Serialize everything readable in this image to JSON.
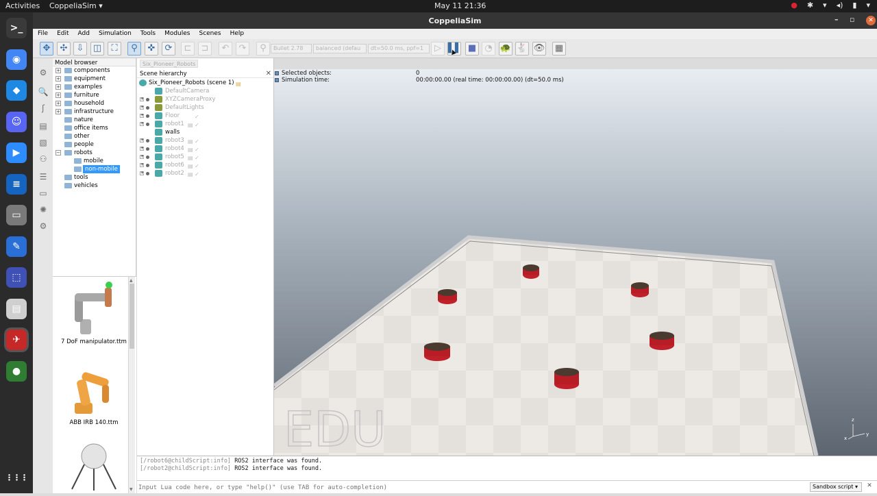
{
  "topbar": {
    "activities": "Activities",
    "app": "CoppeliaSim ▾",
    "clock": "May 11  21:36",
    "tray": [
      "●",
      "✱",
      "▾",
      "◂)",
      "▮",
      "▾"
    ]
  },
  "dock": {
    "apps": [
      {
        "name": "terminal",
        "glyph": ">_",
        "color": "#3a3a3a"
      },
      {
        "name": "chrome",
        "glyph": "◉",
        "color": "#4285f4"
      },
      {
        "name": "vscode",
        "glyph": "◆",
        "color": "#1e88e5"
      },
      {
        "name": "discord",
        "glyph": "☺",
        "color": "#5865f2"
      },
      {
        "name": "zoom",
        "glyph": "▶",
        "color": "#2d8cff"
      },
      {
        "name": "libreoffice-writer",
        "glyph": "≡",
        "color": "#1565c0"
      },
      {
        "name": "files",
        "glyph": "▭",
        "color": "#7a7a7a"
      },
      {
        "name": "text-editor",
        "glyph": "✎",
        "color": "#2a6fd6"
      },
      {
        "name": "screenshot",
        "glyph": "⬚",
        "color": "#3f51b5"
      },
      {
        "name": "document-viewer",
        "glyph": "▤",
        "color": "#cfcfcf"
      },
      {
        "name": "coppeliasim",
        "glyph": "✈",
        "color": "#c62828"
      },
      {
        "name": "earth",
        "glyph": "●",
        "color": "#2e7d32"
      }
    ],
    "grid": "⋮⋮⋮"
  },
  "window": {
    "title": "CoppeliaSim",
    "min": "–",
    "restore": "▫",
    "close": "✕"
  },
  "menu": [
    "File",
    "Edit",
    "Add",
    "Simulation",
    "Tools",
    "Modules",
    "Scenes",
    "Help"
  ],
  "toolbar": {
    "engine": "Bullet 2.78",
    "accuracy": "balanced (defau",
    "dt": "dt=50.0 ms, ppf=1",
    "cursor": "▲"
  },
  "model_browser": {
    "title": "Model browser",
    "items": [
      {
        "label": "components",
        "expand": "+"
      },
      {
        "label": "equipment",
        "expand": "+"
      },
      {
        "label": "examples",
        "expand": "+"
      },
      {
        "label": "furniture",
        "expand": "+"
      },
      {
        "label": "household",
        "expand": "+"
      },
      {
        "label": "infrastructure",
        "expand": "+"
      },
      {
        "label": "nature",
        "expand": ""
      },
      {
        "label": "office items",
        "expand": ""
      },
      {
        "label": "other",
        "expand": ""
      },
      {
        "label": "people",
        "expand": ""
      },
      {
        "label": "robots",
        "expand": "−"
      },
      {
        "label": "mobile",
        "expand": ""
      },
      {
        "label": "non-mobile",
        "expand": ""
      },
      {
        "label": "tools",
        "expand": ""
      },
      {
        "label": "vehicles",
        "expand": ""
      }
    ],
    "thumbnails": [
      "7 DoF manipulator.ttm",
      "ABB IRB 140.ttm"
    ]
  },
  "scene": {
    "tab": "Six_Pioneer_Robots",
    "title": "Scene hierarchy",
    "close": "✕",
    "root": "Six_Pioneer_Robots (scene 1)",
    "items": [
      {
        "label": "DefaultCamera",
        "color": "#4aa8a8"
      },
      {
        "label": "XYZCameraProxy",
        "color": "#8a9a3a"
      },
      {
        "label": "DefaultLights",
        "color": "#8a9a3a"
      },
      {
        "label": "Floor",
        "color": "#4aa8a8"
      },
      {
        "label": "robot1",
        "color": "#4aa8a8"
      },
      {
        "label": "walls",
        "color": "#4aa8a8"
      },
      {
        "label": "robot3",
        "color": "#4aa8a8"
      },
      {
        "label": "robot4",
        "color": "#4aa8a8"
      },
      {
        "label": "robot5",
        "color": "#4aa8a8"
      },
      {
        "label": "robot6",
        "color": "#4aa8a8"
      },
      {
        "label": "robot2",
        "color": "#4aa8a8"
      }
    ]
  },
  "info": {
    "selected_label": "Selected objects:",
    "selected_value": "0",
    "simtime_label": "Simulation time:",
    "simtime_value": "00:00:00.00 (real time: 00:00:00.00) (dt=50.0 ms)"
  },
  "viewport": {
    "watermark": "EDU",
    "axes": {
      "z": "z",
      "y": "y",
      "x": "x"
    }
  },
  "console": {
    "lines": [
      {
        "prefix": "[/robot6@childScript:info]",
        "msg": "ROS2 interface was found."
      },
      {
        "prefix": "[/robot2@childScript:info]",
        "msg": "ROS2 interface was found."
      }
    ],
    "placeholder": "Input Lua code here, or type \"help()\" (use TAB for auto-completion)",
    "script_mode": "Sandbox script ▾",
    "close": "✕"
  }
}
